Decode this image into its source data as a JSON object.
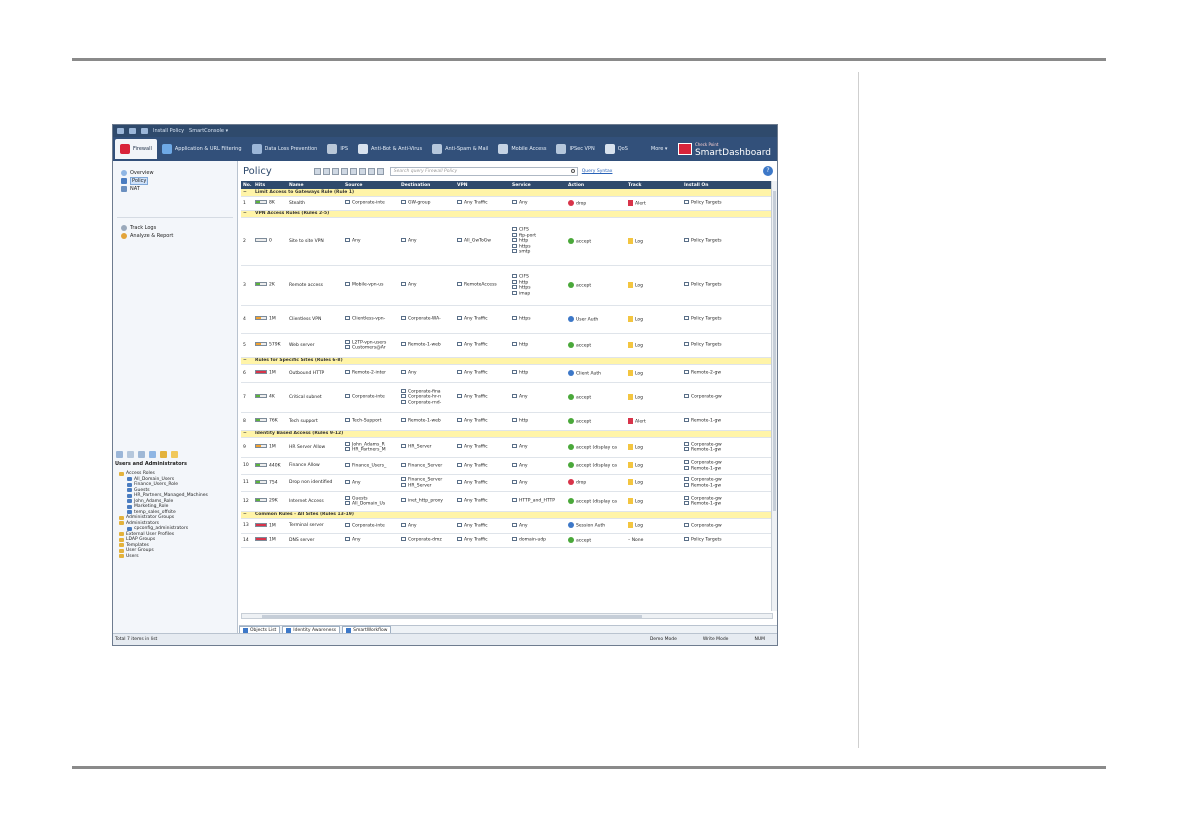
{
  "titlebar": {
    "install": "Install Policy",
    "console": "SmartConsole ▾"
  },
  "ribbon": {
    "tabs": [
      {
        "label": "Firewall",
        "color": "#d9243a"
      },
      {
        "label": "Application & URL Filtering",
        "color": "#6ea9e6"
      },
      {
        "label": "Data Loss Prevention",
        "color": "#9bb6d8"
      },
      {
        "label": "IPS",
        "color": "#b9c7d8"
      },
      {
        "label": "Anti-Bot & Anti-Virus",
        "color": "#d8e2ee"
      },
      {
        "label": "Anti-Spam & Mail",
        "color": "#b5c7dc"
      },
      {
        "label": "Mobile Access",
        "color": "#c5d3e4"
      },
      {
        "label": "IPSec VPN",
        "color": "#b5c7dc"
      },
      {
        "label": "QoS",
        "color": "#d8e2ee"
      },
      {
        "label": "More ▾",
        "color": "#32507a"
      }
    ],
    "brand_top": "Check Point",
    "brand_name": "SmartDashboard"
  },
  "nav": {
    "overview": "Overview",
    "policy": "Policy",
    "nat": "NAT",
    "track_logs": "Track Logs",
    "analyze": "Analyze & Report"
  },
  "objects": {
    "title": "Users and Administrators",
    "tree": [
      {
        "label": "Access Roles",
        "kind": "f",
        "indent": 0
      },
      {
        "label": "All_Domain_Users",
        "kind": "u",
        "indent": 2
      },
      {
        "label": "Finance_Users_Role",
        "kind": "u",
        "indent": 2
      },
      {
        "label": "Guests",
        "kind": "u",
        "indent": 2
      },
      {
        "label": "HR_Partners_Managed_Machines",
        "kind": "u",
        "indent": 2
      },
      {
        "label": "John_Adams_Role",
        "kind": "u",
        "indent": 2
      },
      {
        "label": "Marketing_Role",
        "kind": "u",
        "indent": 2
      },
      {
        "label": "temp_sales_offsite",
        "kind": "u",
        "indent": 2
      },
      {
        "label": "Administrator Groups",
        "kind": "f",
        "indent": 0
      },
      {
        "label": "Administrators",
        "kind": "f",
        "indent": 0
      },
      {
        "label": "cpconfig_administrators",
        "kind": "u",
        "indent": 2
      },
      {
        "label": "External User Profiles",
        "kind": "f",
        "indent": 0
      },
      {
        "label": "LDAP Groups",
        "kind": "f",
        "indent": 0
      },
      {
        "label": "Templates",
        "kind": "f",
        "indent": 0
      },
      {
        "label": "User Groups",
        "kind": "f",
        "indent": 0
      },
      {
        "label": "Users",
        "kind": "f",
        "indent": 0
      }
    ]
  },
  "policy": {
    "title": "Policy",
    "search_placeholder": "Search query Firewall Policy",
    "query_syntax": "Query Syntax",
    "help": "?",
    "columns": [
      "No.",
      "Hits",
      "Name",
      "Source",
      "Destination",
      "VPN",
      "Service",
      "Action",
      "Track",
      "Install On"
    ],
    "rows": [
      {
        "section": "Limit Access to Gateways Rule  (Rule 1)"
      },
      {
        "no": "1",
        "hits": "8K",
        "hb": "hb-g",
        "name": "Stealth",
        "source": [
          "Corporate-inte"
        ],
        "destination": [
          "GW-group"
        ],
        "vpn": "Any Traffic",
        "service": [
          "Any"
        ],
        "action": "drop",
        "act": "drop",
        "track": "Alert",
        "trk": "alert",
        "install": [
          "Policy Targets"
        ],
        "h": 14
      },
      {
        "section": "VPN Access Rules  (Rules 2-5)"
      },
      {
        "no": "2",
        "hits": "0",
        "hb": "hb-e",
        "name": "Site to site VPN",
        "source": [
          "Any"
        ],
        "destination": [
          "Any"
        ],
        "vpn": "All_GwToGw",
        "service": [
          "CIFS",
          "ftp-port",
          "http",
          "https",
          "smtp"
        ],
        "action": "accept",
        "act": "accept",
        "track": "Log",
        "trk": "",
        "install": [
          "Policy Targets"
        ],
        "h": 48
      },
      {
        "no": "3",
        "hits": "2K",
        "hb": "hb-g",
        "name": "Remote access",
        "source": [
          "Mobile-vpn-us"
        ],
        "destination": [
          "Any"
        ],
        "vpn": "RemoteAccess",
        "service": [
          "CIFS",
          "http",
          "https",
          "imap"
        ],
        "action": "accept",
        "act": "accept",
        "track": "Log",
        "trk": "",
        "install": [
          "Policy Targets"
        ],
        "h": 40
      },
      {
        "no": "4",
        "hits": "1M",
        "hb": "hb-o",
        "name": "Clientless VPN",
        "source": [
          "Clientless-vpn-"
        ],
        "destination": [
          "Corporate-WA-"
        ],
        "vpn": "Any Traffic",
        "service": [
          "https"
        ],
        "action": "User Auth",
        "act": "auth",
        "track": "Log",
        "trk": "",
        "install": [
          "Policy Targets"
        ],
        "h": 28
      },
      {
        "no": "5",
        "hits": "579K",
        "hb": "hb-o",
        "name": "Web server",
        "source": [
          "L2TP-vpn-users",
          "Customers@Ar"
        ],
        "destination": [
          "Remote-1-web"
        ],
        "vpn": "Any Traffic",
        "service": [
          "http"
        ],
        "action": "accept",
        "act": "accept",
        "track": "Log",
        "trk": "",
        "install": [
          "Policy Targets"
        ],
        "h": 24
      },
      {
        "section": "Rules for Specific Sites  (Rules 6-8)"
      },
      {
        "no": "6",
        "hits": "1M",
        "hb": "hb-r",
        "name": "Outbound HTTP",
        "source": [
          "Remote-2-inter"
        ],
        "destination": [
          "Any"
        ],
        "vpn": "Any Traffic",
        "service": [
          "http"
        ],
        "action": "Client Auth",
        "act": "auth",
        "track": "Log",
        "trk": "",
        "install": [
          "Remote-2-gw"
        ],
        "h": 18
      },
      {
        "no": "7",
        "hits": "4K",
        "hb": "hb-g",
        "name": "Critical subnet",
        "source": [
          "Corporate-inte"
        ],
        "destination": [
          "Corporate-fina",
          "Corporate-hr-n",
          "Corporate-rnd-"
        ],
        "vpn": "Any Traffic",
        "service": [
          "Any"
        ],
        "action": "accept",
        "act": "accept",
        "track": "Log",
        "trk": "",
        "install": [
          "Corporate-gw"
        ],
        "h": 30
      },
      {
        "no": "8",
        "hits": "76K",
        "hb": "hb-g",
        "name": "Tech support",
        "source": [
          "Tech-Support"
        ],
        "destination": [
          "Remote-1-web"
        ],
        "vpn": "Any Traffic",
        "service": [
          "http"
        ],
        "action": "accept",
        "act": "accept",
        "track": "Alert",
        "trk": "alert",
        "install": [
          "Remote-1-gw"
        ],
        "h": 18
      },
      {
        "section": "Identity Based Access  (Rules 9-12)"
      },
      {
        "no": "9",
        "hits": "1M",
        "hb": "hb-o",
        "name": "HR Server Allow",
        "source": [
          "John_Adams_R",
          "HR_Partners_M"
        ],
        "destination": [
          "HR_Server"
        ],
        "vpn": "Any Traffic",
        "service": [
          "Any"
        ],
        "action": "accept (display ca",
        "act": "accept",
        "track": "Log",
        "trk": "",
        "install": [
          "Corporate-gw",
          "Remote-1-gw"
        ],
        "h": 20
      },
      {
        "no": "10",
        "hits": "440K",
        "hb": "hb-g",
        "name": "Finance Allow",
        "source": [
          "Finance_Users_"
        ],
        "destination": [
          "Finance_Server"
        ],
        "vpn": "Any Traffic",
        "service": [
          "Any"
        ],
        "action": "accept (display ca",
        "act": "accept",
        "track": "Log",
        "trk": "",
        "install": [
          "Corporate-gw",
          "Remote-1-gw"
        ],
        "h": 17
      },
      {
        "no": "11",
        "hits": "754",
        "hb": "hb-g",
        "name": "Drop non identified",
        "source": [
          "Any"
        ],
        "destination": [
          "Finance_Server",
          "HR_Server"
        ],
        "vpn": "Any Traffic",
        "service": [
          "Any"
        ],
        "action": "drop",
        "act": "drop",
        "track": "Log",
        "trk": "",
        "install": [
          "Corporate-gw",
          "Remote-1-gw"
        ],
        "h": 17
      },
      {
        "no": "12",
        "hits": "29K",
        "hb": "hb-g",
        "name": "Internet Access",
        "source": [
          "Guests",
          "All_Domain_Us"
        ],
        "destination": [
          "inet_http_proxy"
        ],
        "vpn": "Any Traffic",
        "service": [
          "HTTP_and_HTTP"
        ],
        "action": "accept (display ca",
        "act": "accept",
        "track": "Log",
        "trk": "",
        "install": [
          "Corporate-gw",
          "Remote-1-gw"
        ],
        "h": 20
      },
      {
        "section": "Common Rules - All Sites  (Rules 13-19)"
      },
      {
        "no": "13",
        "hits": "1M",
        "hb": "hb-r",
        "name": "Terminal server",
        "source": [
          "Corporate-inte"
        ],
        "destination": [
          "Any"
        ],
        "vpn": "Any Traffic",
        "service": [
          "Any"
        ],
        "action": "Session Auth",
        "act": "auth",
        "track": "Log",
        "trk": "",
        "install": [
          "Corporate-gw"
        ],
        "h": 15
      },
      {
        "no": "14",
        "hits": "1M",
        "hb": "hb-r",
        "name": "DNS server",
        "source": [
          "Any"
        ],
        "destination": [
          "Corporate-dmz"
        ],
        "vpn": "Any Traffic",
        "service": [
          "domain-udp"
        ],
        "action": "accept",
        "act": "accept",
        "track": "None",
        "trk": "none",
        "install": [
          "Policy Targets"
        ],
        "h": 14
      }
    ]
  },
  "bottom_tabs": [
    "Objects List",
    "Identity Awareness",
    "SmartWorkflow"
  ],
  "status": {
    "left": "Total 7 items in list",
    "demo": "Demo Mode",
    "write": "Write Mode",
    "num": "NUM"
  }
}
